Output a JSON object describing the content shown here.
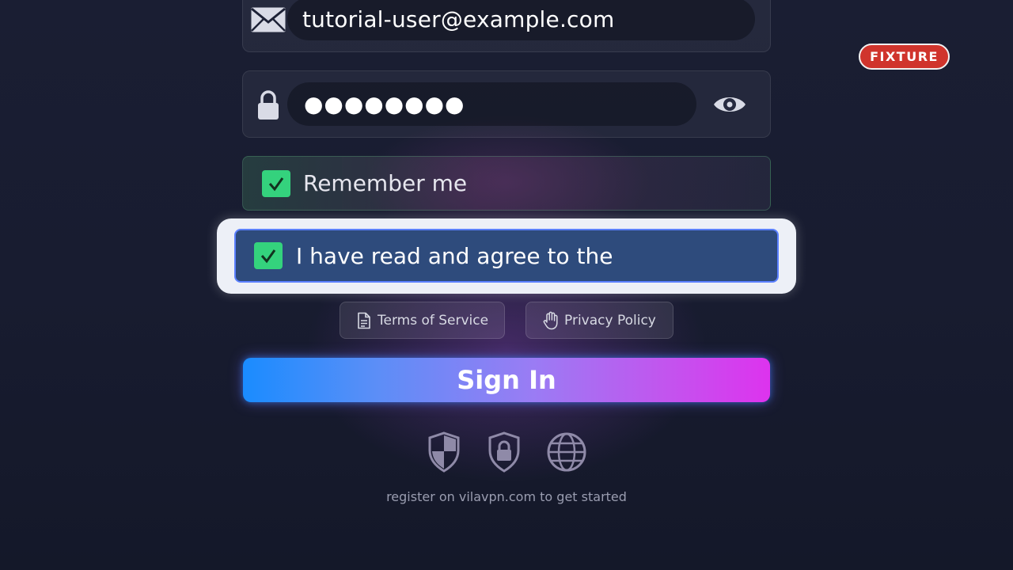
{
  "badge": {
    "text": "FIXTURE"
  },
  "email": {
    "icon": "envelope-icon",
    "value": "tutorial-user@example.com"
  },
  "password": {
    "icon": "lock-icon",
    "masked_value": "●●●●●●●●",
    "toggle_icon": "eye-icon"
  },
  "remember": {
    "checked": true,
    "label": "Remember me"
  },
  "agree": {
    "checked": true,
    "label": "I have read and agree to the"
  },
  "links": {
    "terms": {
      "icon": "document-icon",
      "label": "Terms of Service"
    },
    "privacy": {
      "icon": "hand-icon",
      "label": "Privacy Policy"
    }
  },
  "signin": {
    "label": "Sign In"
  },
  "trust_icons": [
    "shield-icon",
    "shield-lock-icon",
    "globe-icon"
  ],
  "footer": {
    "text": "register on vilavpn.com to get started"
  },
  "colors": {
    "accent_start": "#1a8cff",
    "accent_end": "#dd33ee",
    "check_green": "#34d27d",
    "badge_red": "#d0342c",
    "agree_focus": "#2e4b7c"
  }
}
